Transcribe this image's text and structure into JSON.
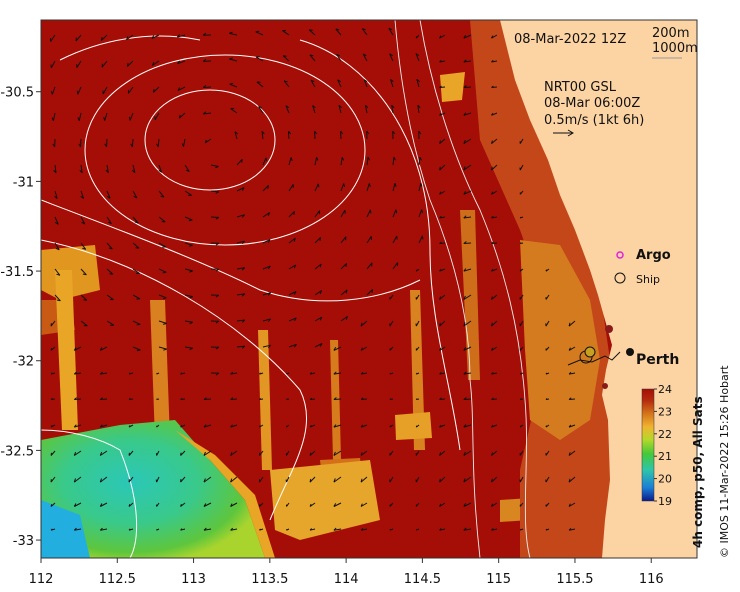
{
  "map": {
    "date_label": "08-Mar-2022 12Z",
    "depth_contours": [
      "200m",
      "1000m"
    ],
    "product": {
      "name": "NRT00 GSL",
      "time": "08-Mar 06:00Z",
      "vector_scale": "0.5m/s (1kt 6h)"
    },
    "legend": {
      "argo_label": "Argo",
      "ship_label": "Ship",
      "argo_color": "#e020e0"
    },
    "places": [
      {
        "name": "Perth",
        "lon": 115.86,
        "lat": -31.95
      }
    ],
    "x_ticks": [
      "112",
      "112.5",
      "113",
      "113.5",
      "114",
      "114.5",
      "115",
      "115.5",
      "116"
    ],
    "y_ticks": [
      "-30.5",
      "-31",
      "-31.5",
      "-32",
      "-32.5",
      "-33"
    ],
    "x_range": [
      112,
      116.3
    ],
    "y_range": [
      -33.1,
      -30.1
    ],
    "colorbar": {
      "label": "4h comp, p50, All Sats",
      "ticks": [
        "24",
        "23",
        "22",
        "21",
        "20",
        "19"
      ],
      "range": [
        19,
        24
      ],
      "colors": [
        "#0b1a8a",
        "#1b7fd6",
        "#2fc6a8",
        "#46c83a",
        "#b6d82a",
        "#f0b430",
        "#d4741a",
        "#b52a0e",
        "#a50e06"
      ]
    },
    "credit": "© IMOS 11-Mar-2022 15:26 Hobart",
    "land_color": "#fcd4a4",
    "warm_water_color": "#a50e06"
  }
}
